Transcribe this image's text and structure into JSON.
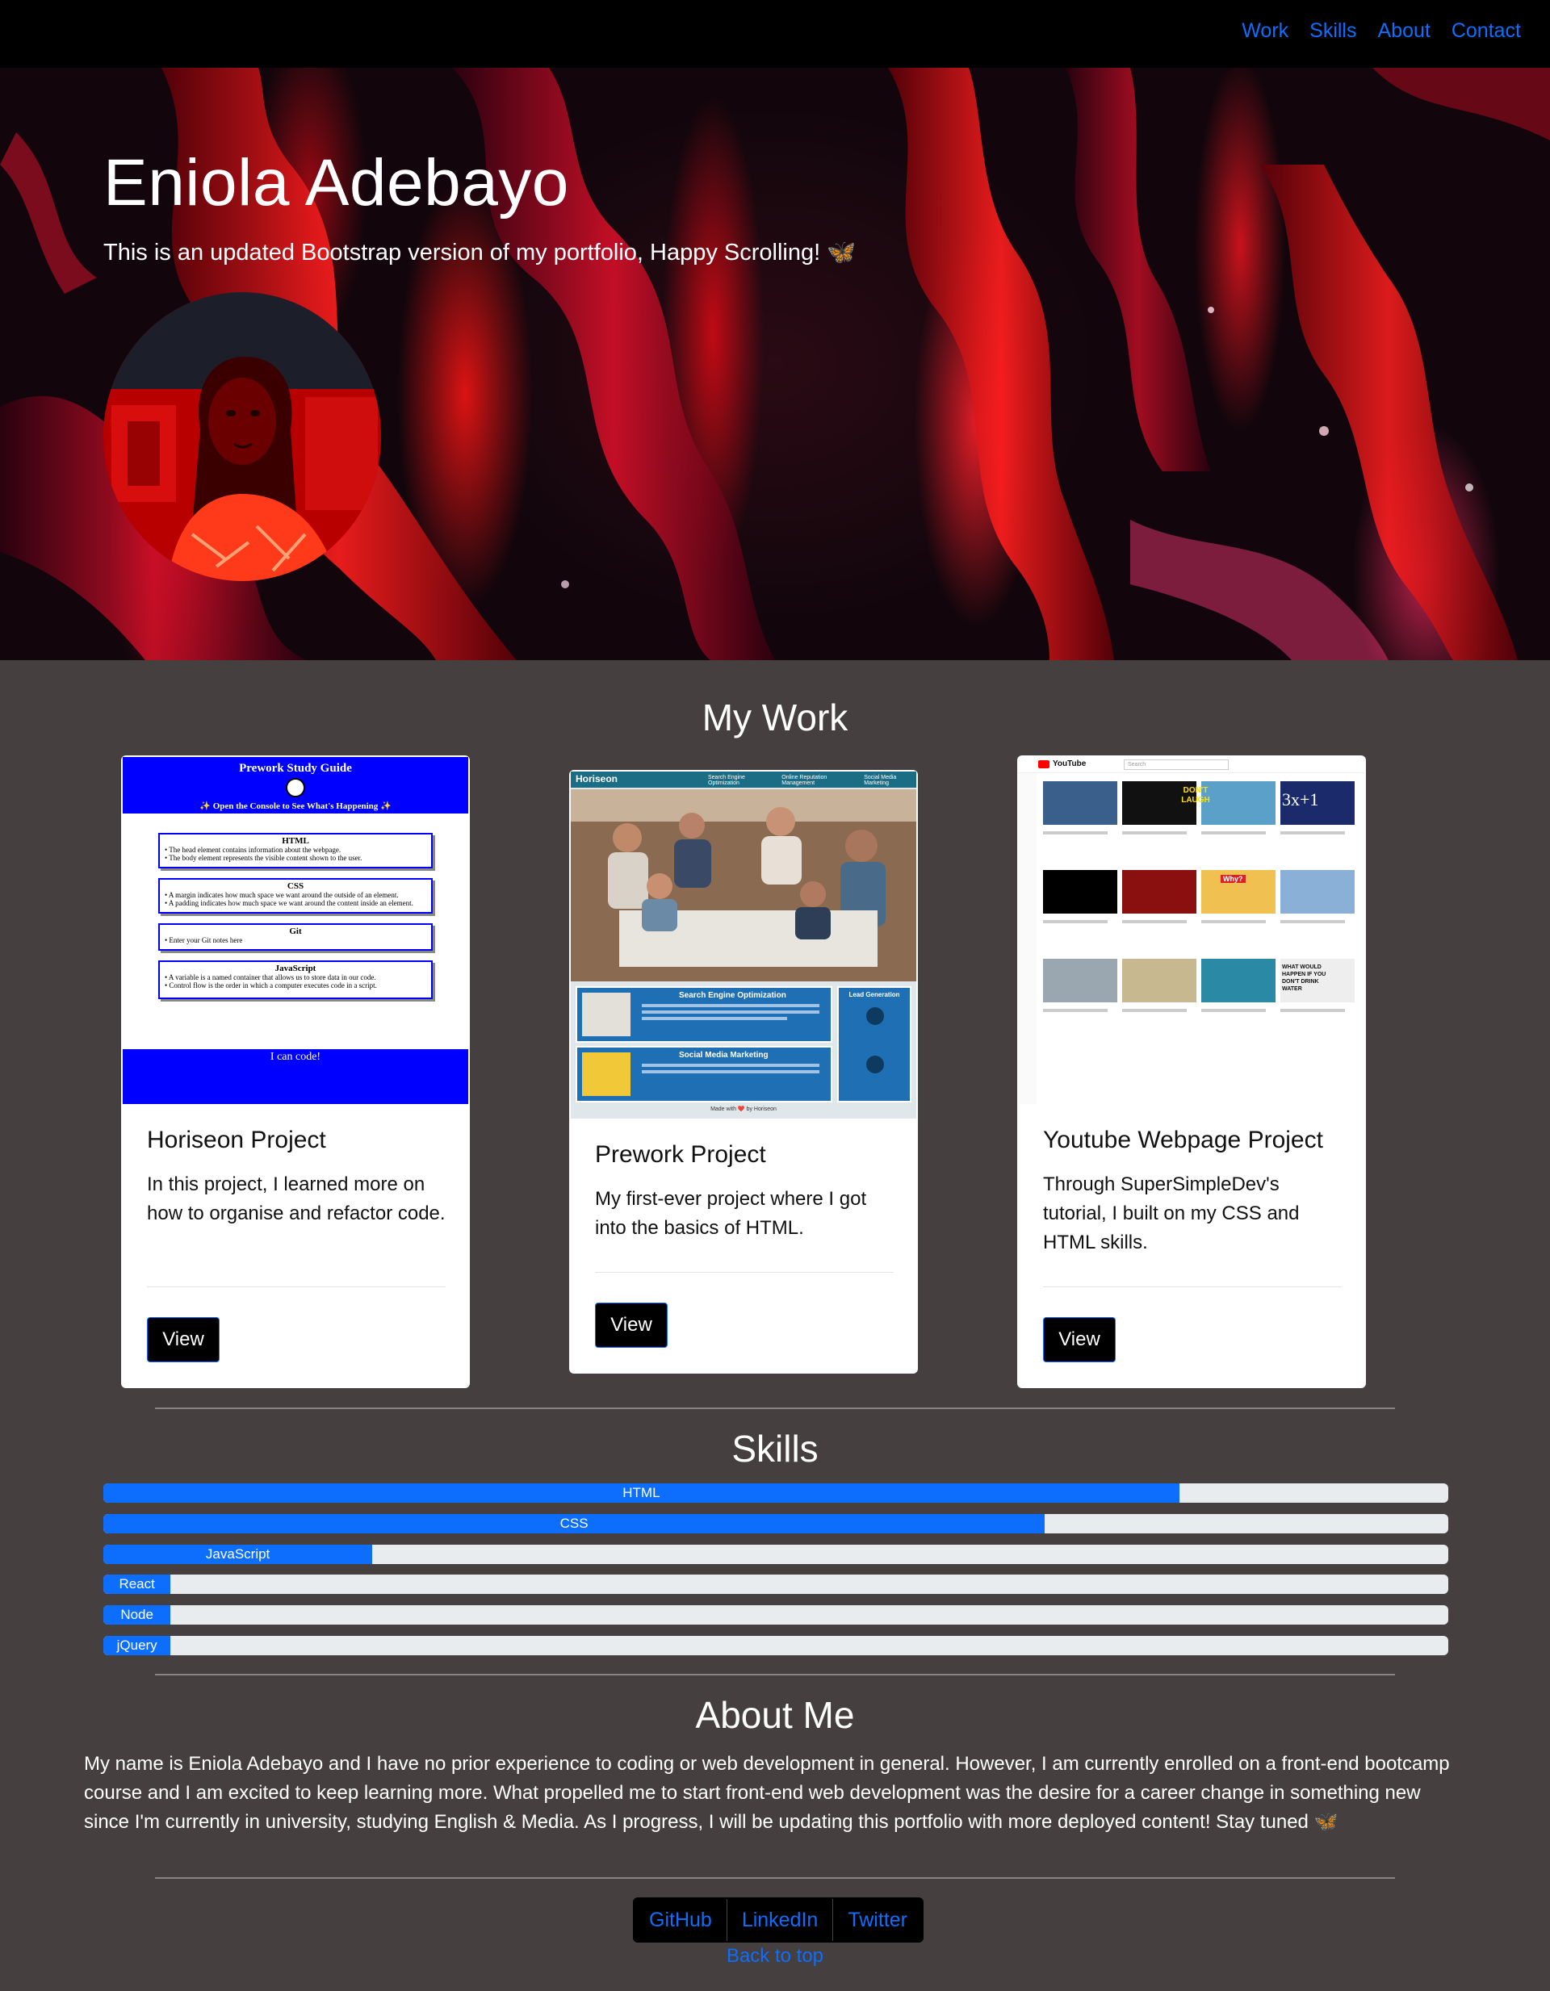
{
  "nav": {
    "links": [
      "Work",
      "Skills",
      "About",
      "Contact"
    ],
    "link_color": "#0d6efd"
  },
  "hero": {
    "title": "Eniola Adebayo",
    "subtitle": "This is an updated Bootstrap version of my portfolio, Happy Scrolling! 🦋"
  },
  "work": {
    "heading": "My Work",
    "cards": [
      {
        "title": "Horiseon Project",
        "text": "In this project, I learned more on how to organise and refactor code.",
        "button": "View",
        "thumb": {
          "header": "Prework Study Guide",
          "subheader": "✨ Open the Console to See What's Happening ✨",
          "sections": [
            {
              "title": "HTML",
              "lines": [
                "• The head element contains information about the webpage.",
                "• The body element represents the visible content shown to the user."
              ]
            },
            {
              "title": "CSS",
              "lines": [
                "• A margin indicates how much space we want around the outside of an element.",
                "• A padding indicates how much space we want around the content inside an element."
              ]
            },
            {
              "title": "Git",
              "lines": [
                "• Enter your Git notes here"
              ]
            },
            {
              "title": "JavaScript",
              "lines": [
                "• A variable is a named container that allows us to store data in our code.",
                "• Control flow is the order in which a computer executes code in a script."
              ]
            }
          ],
          "footer": "I can code!"
        }
      },
      {
        "title": "Prework Project",
        "text": "My first-ever project where I got into the basics of HTML.",
        "button": "View",
        "thumb": {
          "brand": "Horiseon",
          "menu": [
            "Search Engine Optimization",
            "Online Reputation Management",
            "Social Media Marketing"
          ],
          "panel1": "Search Engine Optimization",
          "panel2": "Social Media Marketing",
          "side": "Lead Generation",
          "footer": "Made with ❤️ by Horiseon"
        }
      },
      {
        "title": "Youtube Webpage Project",
        "text": "Through SuperSimpleDev's tutorial, I built on my CSS and HTML skills.",
        "button": "View",
        "thumb": {
          "logo": "YouTube",
          "search_placeholder": "Search",
          "overlays": [
            "DON'T LAUGH",
            "3x+1",
            "Why?",
            "WHAT WOULD HAPPEN IF YOU DON'T DRINK WATER"
          ]
        }
      }
    ]
  },
  "skills": {
    "heading": "Skills",
    "items": [
      {
        "label": "HTML",
        "percent": 80
      },
      {
        "label": "CSS",
        "percent": 70
      },
      {
        "label": "JavaScript",
        "percent": 20
      },
      {
        "label": "React",
        "percent": 5
      },
      {
        "label": "Node",
        "percent": 5
      },
      {
        "label": "jQuery",
        "percent": 5
      }
    ],
    "fill_color": "#0d6efd",
    "track_color": "#e9ecef"
  },
  "about": {
    "heading": "About Me",
    "text": "My name is Eniola Adebayo and I have no prior experience to coding or web development in general. However, I am currently enrolled on a front-end bootcamp course and I am excited to keep learning more. What propelled me to start front-end web development was the desire for a career change in something new since I'm currently in university, studying English & Media. As I progress, I will be updating this portfolio with more deployed content! Stay tuned 🦋"
  },
  "footer": {
    "socials": [
      "GitHub",
      "LinkedIn",
      "Twitter"
    ],
    "back_to_top": "Back to top"
  }
}
